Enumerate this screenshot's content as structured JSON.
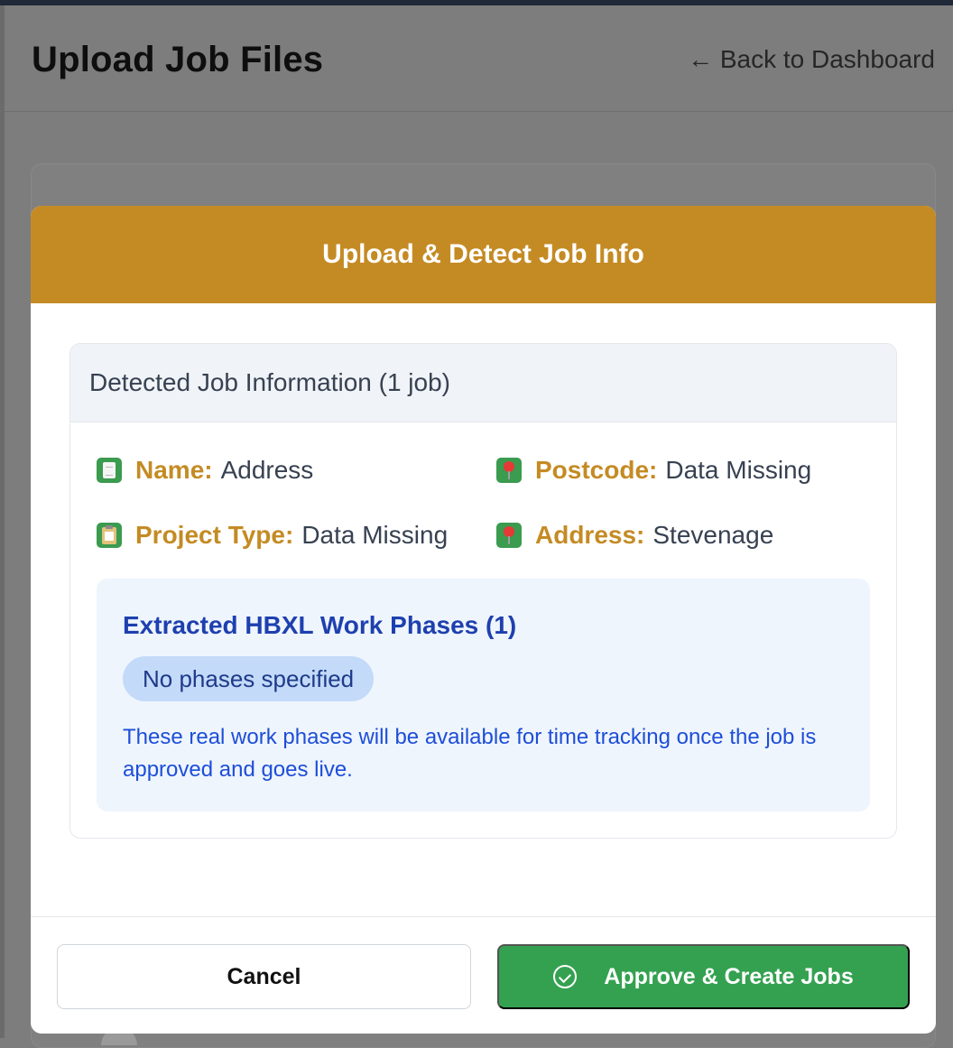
{
  "page": {
    "title": "Upload Job Files",
    "back_link": "← Back to Dashboard"
  },
  "modal": {
    "title": "Upload & Detect Job Info",
    "card_title": "Detected Job Information (1 job)",
    "fields": [
      {
        "label": "Name:",
        "value": "Address",
        "icon": "document-icon"
      },
      {
        "label": "Postcode:",
        "value": "Data Missing",
        "icon": "pin-icon"
      },
      {
        "label": "Project Type:",
        "value": "Data Missing",
        "icon": "clipboard-icon"
      },
      {
        "label": "Address:",
        "value": "Stevenage",
        "icon": "pin-icon"
      }
    ],
    "phases": {
      "title": "Extracted HBXL Work Phases (1)",
      "pill": "No phases specified",
      "note": "These real work phases will be available for time tracking once the job is approved and goes live."
    },
    "buttons": {
      "cancel": "Cancel",
      "approve": "Approve & Create Jobs"
    }
  },
  "colors": {
    "header": "#c48b24",
    "label": "#c48b24",
    "approve": "#34a150",
    "phases_bg": "#eff5fd",
    "phases_text": "#1d4ed8"
  }
}
